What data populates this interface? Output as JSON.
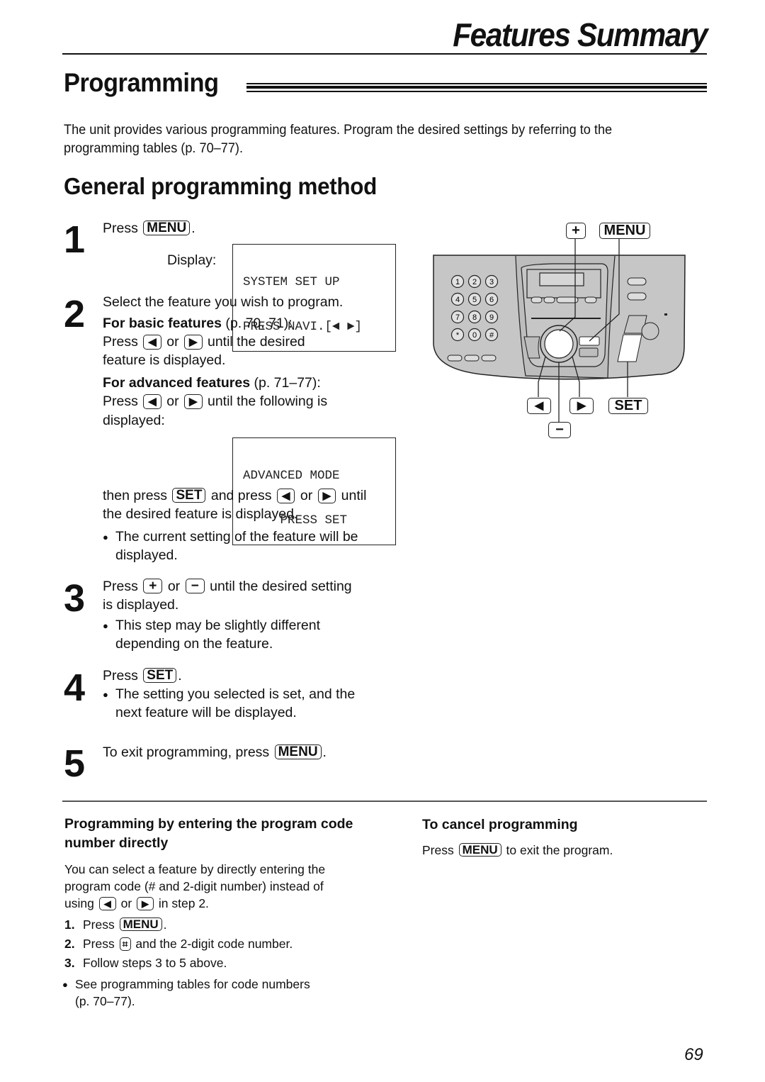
{
  "header": {
    "title": "Features Summary"
  },
  "section": {
    "title": "Programming"
  },
  "intro": "The unit provides various programming features. Program the desired settings by referring to the programming tables (p. 70–77).",
  "intro_lines": [
    "The unit provides various programming features. Program the desired settings by referring to the",
    "programming tables (p. 70–77)."
  ],
  "subsection": {
    "title": "General programming method"
  },
  "keys": {
    "menu": "MENU",
    "set": "SET",
    "plus": "+",
    "minus": "−",
    "left": "◀",
    "right": "▶",
    "hash": "⌗"
  },
  "steps": [
    {
      "number": "1",
      "press": "Press",
      "display_label": "Display:",
      "lcd": [
        "SYSTEM SET UP",
        "PRESS NAVI.[◄ ►]"
      ]
    },
    {
      "number": "2",
      "line1": "Select the feature you wish to program.",
      "basic_label": "For basic features",
      "basic_pages": " (p. 70, 71):",
      "basic_press": "Press",
      "or": "or",
      "basic_tail": "until the desired",
      "basic_line2": "feature is displayed.",
      "advanced_label": "For advanced features",
      "advanced_pages": " (p. 71–77):",
      "advanced_tail": "until the following is",
      "advanced_line2": "displayed:",
      "lcd": [
        "ADVANCED MODE",
        "     PRESS SET"
      ],
      "then_press": "then press",
      "and_press": "and press",
      "until": "until",
      "then_line2": "the desired feature is displayed.",
      "bullet": [
        "The current setting of the feature will be",
        "displayed."
      ]
    },
    {
      "number": "3",
      "press": "Press",
      "or": "or",
      "tail": "until the desired setting",
      "line2": "is displayed.",
      "bullet": [
        "This step may be slightly different",
        "depending on the feature."
      ]
    },
    {
      "number": "4",
      "press": "Press",
      "bullet": [
        "The setting you selected is set, and the",
        "next feature will be displayed."
      ]
    },
    {
      "number": "5",
      "text": "To exit programming, press"
    }
  ],
  "direct_entry": {
    "title_lines": [
      "Programming by entering the program code",
      "number directly"
    ],
    "body_lines": [
      "You can select a feature by directly entering the",
      "program code (# and 2-digit number) instead of"
    ],
    "using": "using",
    "or": "or",
    "in_step": "in step 2.",
    "list": [
      {
        "num": "1.",
        "text_before": "Press",
        "text_after": "."
      },
      {
        "num": "2.",
        "text_before": "Press",
        "text_after": "and the 2-digit code number."
      },
      {
        "num": "3.",
        "text": "Follow steps 3 to 5 above."
      }
    ],
    "note_lines": [
      "See programming tables for code numbers",
      "(p. 70–77)."
    ]
  },
  "cancel": {
    "title": "To cancel programming",
    "press": "Press",
    "tail": "to exit the program."
  },
  "diagram": {
    "keypad": [
      "1",
      "2",
      "3",
      "4",
      "5",
      "6",
      "7",
      "8",
      "9",
      "*",
      "0",
      "#"
    ],
    "colors": {
      "panel": "#c8c8c8",
      "panel_dark": "#b2b2b2",
      "line": "#222222"
    }
  },
  "page_number": "69"
}
